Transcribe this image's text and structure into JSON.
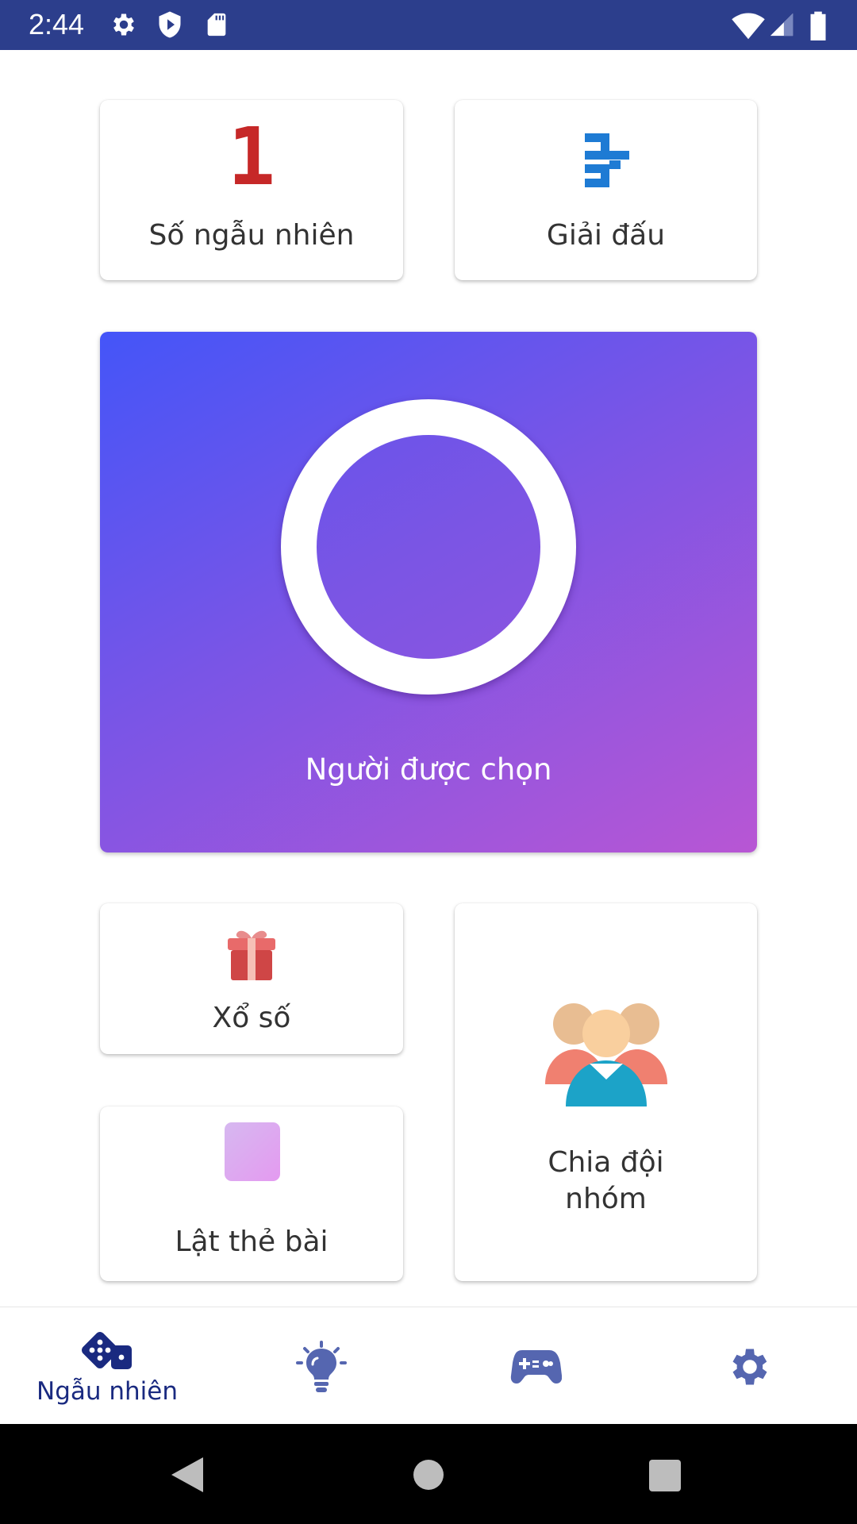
{
  "status_bar": {
    "time": "2:44"
  },
  "cards": {
    "random_number": {
      "icon_text": "1",
      "label": "Số ngẫu nhiên"
    },
    "tournament": {
      "label": "Giải đấu"
    },
    "chosen_person": {
      "label": "Người được chọn"
    },
    "lottery": {
      "label": "Xổ số"
    },
    "flip_card": {
      "label": "Lật thẻ bài"
    },
    "team_split": {
      "label_line1": "Chia đội",
      "label_line2": "nhóm"
    }
  },
  "bottom_nav": {
    "items": [
      {
        "label": "Ngẫu nhiên",
        "icon": "dice-icon",
        "active": true
      },
      {
        "label": "",
        "icon": "lightbulb-icon",
        "active": false
      },
      {
        "label": "",
        "icon": "gamepad-icon",
        "active": false
      },
      {
        "label": "",
        "icon": "settings-gear-icon",
        "active": false
      }
    ]
  },
  "colors": {
    "status_bar": "#2c3e8c",
    "nav_active": "#1a2a80",
    "nav_inactive": "#5566b0",
    "hero_gradient_start": "#4455f8",
    "hero_gradient_end": "#b856d4",
    "number_icon": "#c62828",
    "tournament_icon": "#1e7bd4"
  }
}
